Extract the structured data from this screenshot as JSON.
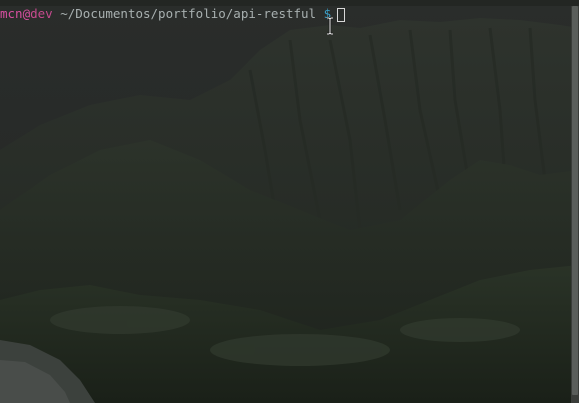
{
  "terminal": {
    "prompt": {
      "user": "mcn",
      "at": "@",
      "host": "dev",
      "path": " ~/Documentos/portfolio/api-restful ",
      "symbol": "$"
    },
    "input": ""
  },
  "colors": {
    "user": "#d64fa0",
    "host": "#c64a8e",
    "path": "#a8b0b0",
    "symbol": "#3aa0c8",
    "background": "#1f221f"
  },
  "icons": {
    "text_cursor": "i-beam-cursor-icon",
    "caret": "block-cursor"
  },
  "scrollbar": {
    "position": 0.0
  }
}
